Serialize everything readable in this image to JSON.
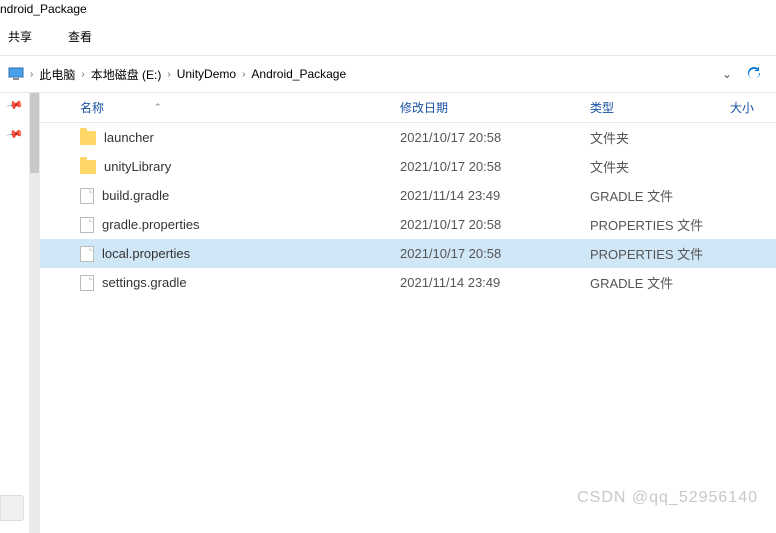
{
  "window": {
    "title": "ndroid_Package"
  },
  "menu": {
    "share": "共享",
    "view": "查看"
  },
  "breadcrumb": {
    "pc": "此电脑",
    "drive": "本地磁盘 (E:)",
    "folder1": "UnityDemo",
    "folder2": "Android_Package"
  },
  "headers": {
    "name": "名称",
    "date": "修改日期",
    "type": "类型",
    "size": "大小"
  },
  "rows": [
    {
      "icon": "folder",
      "name": "launcher",
      "date": "2021/10/17 20:58",
      "type": "文件夹",
      "selected": false
    },
    {
      "icon": "folder",
      "name": "unityLibrary",
      "date": "2021/10/17 20:58",
      "type": "文件夹",
      "selected": false
    },
    {
      "icon": "file",
      "name": "build.gradle",
      "date": "2021/11/14 23:49",
      "type": "GRADLE 文件",
      "selected": false
    },
    {
      "icon": "file",
      "name": "gradle.properties",
      "date": "2021/10/17 20:58",
      "type": "PROPERTIES 文件",
      "selected": false
    },
    {
      "icon": "file",
      "name": "local.properties",
      "date": "2021/10/17 20:58",
      "type": "PROPERTIES 文件",
      "selected": true
    },
    {
      "icon": "file",
      "name": "settings.gradle",
      "date": "2021/11/14 23:49",
      "type": "GRADLE 文件",
      "selected": false
    }
  ],
  "watermark": "CSDN @qq_52956140"
}
